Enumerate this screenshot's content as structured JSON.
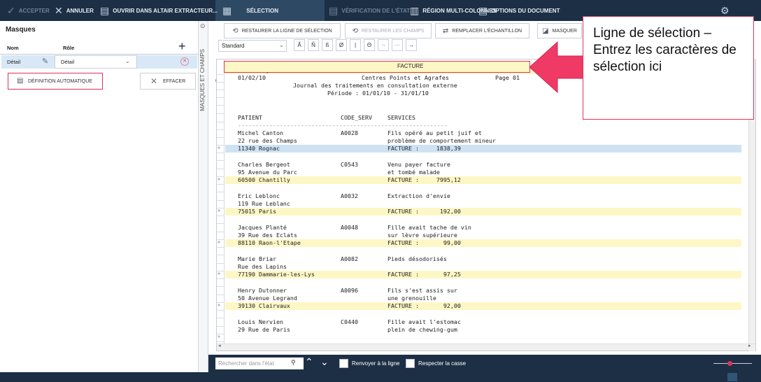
{
  "toolbar": {
    "accept": "ACCEPTER",
    "cancel": "ANNULER",
    "open_extractor": "OUVRIR DANS ALTAIR EXTRACTEUR...",
    "selection": "SÉLECTION",
    "state_check": "VÉRIFICATION DE L'ÉTAT",
    "multicolumn": "RÉGION MULTI-COLONNES",
    "doc_options": "OPTIONS DU DOCUMENT"
  },
  "left": {
    "title": "Masques",
    "col_name": "Nom",
    "col_role": "Rôle",
    "row_name": "Détail",
    "row_role": "Détail",
    "auto_def": "DÉFINITION AUTOMATIQUE",
    "clear": "EFFACER",
    "side_label": "MASQUES ET CHAMPS"
  },
  "actions": {
    "restore_line": "RESTAURER LA LIGNE DE SÉLECTION",
    "restore_fields": "RESTAURER LES CHAMPS",
    "replace_sample": "REMPLACER L'ÉCHANTILLON",
    "mask": "MASQUER",
    "standard": "Standard"
  },
  "format_buttons": [
    "Ã",
    "Ñ",
    "ß",
    "Ø",
    "|",
    "Θ",
    "¬",
    "—",
    "→"
  ],
  "selection_line": "FACTURE",
  "document": {
    "header_rows": [
      {
        "c1": "11340 Rognac",
        "c2": "",
        "c3": "FACTURE :     1838,39",
        "style": "hl"
      },
      {
        "c1": "01/02/10",
        "c2": "        Centres Points et Agrafes",
        "c3": "",
        "page": "Page 01",
        "style": ""
      },
      {
        "c1": "",
        "c2": "Journal des traitements en consultation externe",
        "c3": "",
        "style": ""
      },
      {
        "c1": "",
        "c2": "Période : 01/01/10 - 31/01/10",
        "c3": "",
        "style": ""
      }
    ],
    "columns": {
      "patient": "PATIENT",
      "code": "CODE_SERV",
      "services": "SERVICES"
    },
    "dashes": "------------------------------------------------------------",
    "records": [
      {
        "name": "Michel Canton",
        "code": "A0028",
        "svc1": "Fils opéré au petit juif et",
        "addr": "22 rue des Champs",
        "svc2": "problème de comportement mineur",
        "city": "11340 Rognac",
        "amount": "FACTURE :     1838,39",
        "selected": true
      },
      {
        "name": "Charles Bergeot",
        "code": "C0543",
        "svc1": "Venu payer facture",
        "addr": "95 Avenue du Parc",
        "svc2": "et tombé malade",
        "city": "60500 Chantilly",
        "amount": "FACTURE :     7995,12",
        "selected": false
      },
      {
        "name": "Eric Leblonc",
        "code": "A0032",
        "svc1": "Extraction d'envie",
        "addr": "119 Rue Leblanc",
        "svc2": "",
        "city": "75015 Paris",
        "amount": "FACTURE :      192,00",
        "selected": false
      },
      {
        "name": "Jacques Planté",
        "code": "A0048",
        "svc1": "Fille avait tache de vin",
        "addr": "39 Rue des Eclats",
        "svc2": "sur lèvre supérieure",
        "city": "88110 Raon-l'Etape",
        "amount": "FACTURE :       99,00",
        "selected": false
      },
      {
        "name": "Marie Briar",
        "code": "A0082",
        "svc1": "Pieds désodorisés",
        "addr": "Rue des Lapins",
        "svc2": "",
        "city": "77190 Dammarie-les-Lys",
        "amount": "FACTURE :       97,25",
        "selected": false
      },
      {
        "name": "Henry Dutonner",
        "code": "A0096",
        "svc1": "Fils s'est assis sur",
        "addr": "50 Avenue Legrand",
        "svc2": "une grenouille",
        "city": "39130 Clairvaux",
        "amount": "FACTURE :       92,00",
        "selected": false
      },
      {
        "name": "Louis Nervien",
        "code": "C0440",
        "svc1": "Fille avait l'estomac",
        "addr": "29 Rue de Paris",
        "svc2": "plein de chewing-gum",
        "city": "",
        "amount": "",
        "selected": false
      }
    ]
  },
  "search": {
    "placeholder": "Rechercher dans l'état",
    "wrap": "Renvoyer à la ligne",
    "case": "Respecter la casse"
  },
  "callout": "Ligne de sélection – Entrez les caractères de sélection ici",
  "colors": {
    "topbar": "#1c2f45",
    "highlight": "#fdf7c6",
    "selected": "#cde3f3",
    "accent": "#e0335a"
  }
}
